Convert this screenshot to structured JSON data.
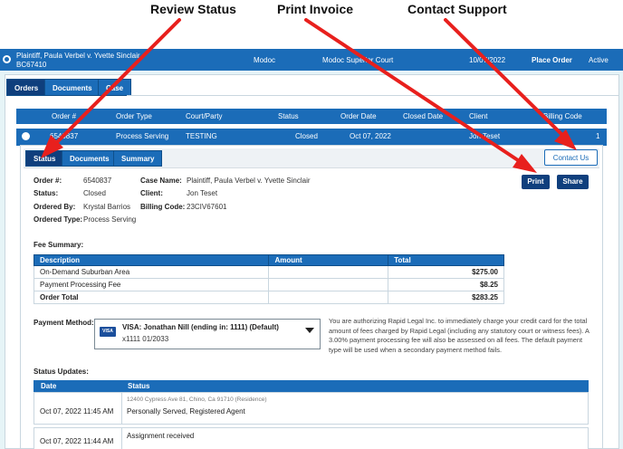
{
  "annotations": {
    "review_status": "Review Status",
    "print_invoice": "Print Invoice",
    "contact_support": "Contact Support"
  },
  "case": {
    "title": "Plaintiff, Paula Verbel v. Yvette Sinclair",
    "number": "BC67410",
    "county": "Modoc",
    "court": "Modoc Superior Court",
    "date": "10/07/2022",
    "place_order": "Place Order",
    "status": "Active"
  },
  "top_tabs": [
    "Orders",
    "Documents",
    "Case"
  ],
  "orders_table": {
    "headers": [
      "Order #",
      "Order Type",
      "Court/Party",
      "Status",
      "Order Date",
      "Closed Date",
      "Client",
      "Billing Code"
    ],
    "row": [
      "6540837",
      "Process Serving",
      "TESTING",
      "Closed",
      "Oct 07, 2022",
      "",
      "Jon Teset",
      "1"
    ]
  },
  "sub_tabs": [
    "Status",
    "Documents",
    "Summary"
  ],
  "contact_us": "Contact Us",
  "print": "Print",
  "share": "Share",
  "detail": {
    "order_num_label": "Order #:",
    "order_num": "6540837",
    "status_label": "Status:",
    "status": "Closed",
    "ordered_by_label": "Ordered By:",
    "ordered_by": "Krystal Barrios",
    "ordered_type_label": "Ordered Type:",
    "ordered_type": "Process Serving",
    "case_name_label": "Case Name:",
    "case_name": "Plaintiff, Paula Verbel v. Yvette Sinclair",
    "client_label": "Client:",
    "client": "Jon Teset",
    "billing_code_label": "Billing Code:",
    "billing_code": "23CIV67601"
  },
  "fee_summary": {
    "title": "Fee Summary:",
    "headers": [
      "Description",
      "Amount",
      "Total"
    ],
    "rows": [
      [
        "On-Demand Suburban Area",
        "",
        "$275.00"
      ],
      [
        "Payment Processing Fee",
        "",
        "$8.25"
      ],
      [
        "Order Total",
        "",
        "$283.25"
      ]
    ]
  },
  "payment": {
    "label": "Payment Method:",
    "card_line1": "VISA: Jonathan Nill (ending in: 1111) (Default)",
    "card_line2": "x1111   01/2033",
    "badge": "VISA",
    "note": "You are authorizing Rapid Legal Inc. to immediately charge your credit card for the total amount of fees charged by Rapid Legal (including any statutory court or witness fees). A 3.00% payment processing fee will also be assessed on all fees. The default payment type will be used when a secondary payment method fails."
  },
  "status_updates": {
    "title": "Status Updates:",
    "headers": [
      "Date",
      "Status"
    ],
    "rows": [
      {
        "date": "Oct 07, 2022 11:45 AM",
        "sub": "12400 Cypress Ave 81, Chino, Ca 91710 (Residence)",
        "status": "Personally Served, Registered Agent"
      },
      {
        "date": "Oct 07, 2022 11:44 AM",
        "sub": "",
        "status": "Assignment received"
      }
    ]
  },
  "colors": {
    "primary": "#1b6cb8",
    "dark": "#0f3f7d",
    "arrow": "#e8201d"
  }
}
